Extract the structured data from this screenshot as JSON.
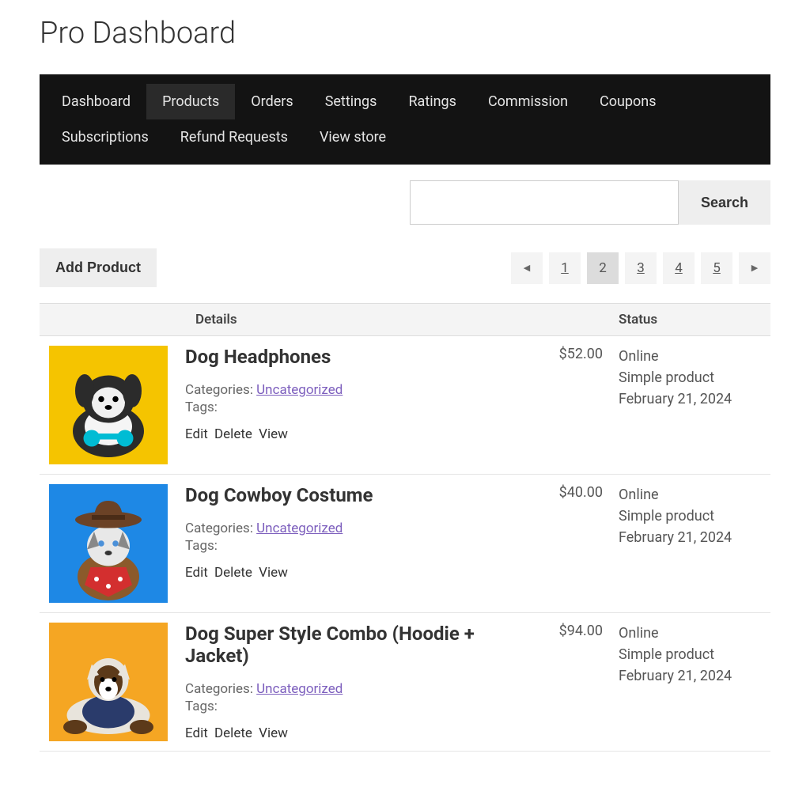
{
  "page_title": "Pro Dashboard",
  "nav": {
    "items": [
      {
        "label": "Dashboard",
        "active": false
      },
      {
        "label": "Products",
        "active": true
      },
      {
        "label": "Orders",
        "active": false
      },
      {
        "label": "Settings",
        "active": false
      },
      {
        "label": "Ratings",
        "active": false
      },
      {
        "label": "Commission",
        "active": false
      },
      {
        "label": "Coupons",
        "active": false
      },
      {
        "label": "Subscriptions",
        "active": false
      },
      {
        "label": "Refund Requests",
        "active": false
      },
      {
        "label": "View store",
        "active": false
      }
    ]
  },
  "search": {
    "button": "Search",
    "value": ""
  },
  "add_product_label": "Add Product",
  "pagination": {
    "pages": [
      "1",
      "2",
      "3",
      "4",
      "5"
    ],
    "current": "2"
  },
  "table": {
    "headers": {
      "details": "Details",
      "status": "Status"
    },
    "labels": {
      "categories": "Categories:",
      "tags": "Tags:",
      "edit": "Edit",
      "delete": "Delete",
      "view": "View"
    }
  },
  "products": [
    {
      "title": "Dog Headphones",
      "price": "$52.00",
      "category": "Uncategorized",
      "tags": "",
      "status": "Online",
      "type": "Simple product",
      "date": "February 21, 2024",
      "thumb_bg": "#f5c400"
    },
    {
      "title": "Dog Cowboy Costume",
      "price": "$40.00",
      "category": "Uncategorized",
      "tags": "",
      "status": "Online",
      "type": "Simple product",
      "date": "February 21, 2024",
      "thumb_bg": "#1e88e5"
    },
    {
      "title": "Dog Super Style Combo (Hoodie + Jacket)",
      "price": "$94.00",
      "category": "Uncategorized",
      "tags": "",
      "status": "Online",
      "type": "Simple product",
      "date": "February 21, 2024",
      "thumb_bg": "#f5a623"
    }
  ]
}
